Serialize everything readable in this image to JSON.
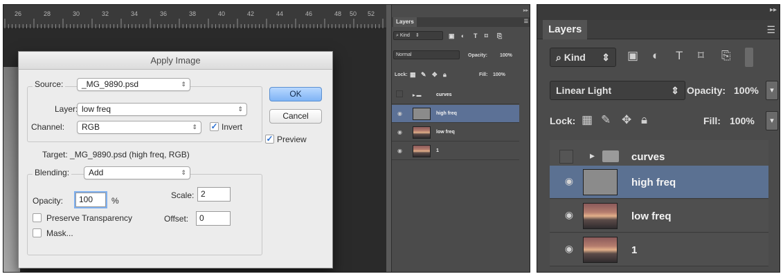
{
  "ruler": {
    "labels": [
      "26",
      "28",
      "30",
      "32",
      "34",
      "36",
      "38",
      "40",
      "42",
      "44",
      "46",
      "48",
      "50",
      "52"
    ]
  },
  "apply_image": {
    "title": "Apply Image",
    "source_label": "Source:",
    "source_value": "_MG_9890.psd",
    "layer_label": "Layer:",
    "layer_value": "low freq",
    "channel_label": "Channel:",
    "channel_value": "RGB",
    "invert_label": "Invert",
    "invert_checked": true,
    "target_text": "Target:  _MG_9890.psd (high freq, RGB)",
    "blending_label": "Blending:",
    "blending_value": "Add",
    "opacity_label": "Opacity:",
    "opacity_value": "100",
    "opacity_unit": "%",
    "scale_label": "Scale:",
    "scale_value": "2",
    "offset_label": "Offset:",
    "offset_value": "0",
    "preserve_transparency_label": "Preserve Transparency",
    "mask_label": "Mask...",
    "ok_label": "OK",
    "cancel_label": "Cancel",
    "preview_label": "Preview",
    "preview_checked": true
  },
  "layers_small": {
    "tab": "Layers",
    "kind": "Kind",
    "blend_mode": "Normal",
    "opacity_label": "Opacity:",
    "opacity_value": "100%",
    "lock_label": "Lock:",
    "fill_label": "Fill:",
    "fill_value": "100%",
    "layers": [
      {
        "name": "curves"
      },
      {
        "name": "high freq"
      },
      {
        "name": "low freq"
      },
      {
        "name": "1"
      }
    ]
  },
  "layers_panel": {
    "tab": "Layers",
    "kind": "Kind",
    "blend_mode": "Linear Light",
    "opacity_label": "Opacity:",
    "opacity_value": "100%",
    "lock_label": "Lock:",
    "fill_label": "Fill:",
    "fill_value": "100%",
    "layers": [
      {
        "name": "curves",
        "type": "group",
        "visible": false,
        "selected": false
      },
      {
        "name": "high freq",
        "type": "layer",
        "visible": true,
        "selected": true
      },
      {
        "name": "low freq",
        "type": "layer",
        "visible": true,
        "selected": false
      },
      {
        "name": "1",
        "type": "layer",
        "visible": true,
        "selected": false
      }
    ]
  },
  "colors": {
    "selected_row": "#5b7192",
    "panel_bg": "#4b4b4b",
    "dialog_bg": "#ececec",
    "ok_button": "#7fb4f5"
  }
}
